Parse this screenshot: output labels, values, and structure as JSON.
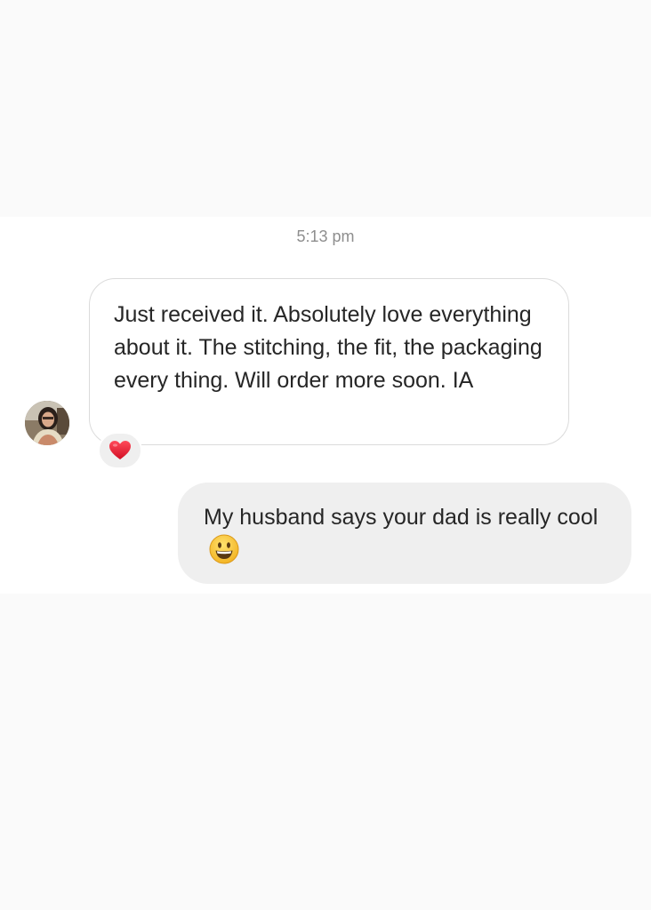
{
  "conversation": {
    "timestamp": "5:13 pm",
    "messages": [
      {
        "direction": "incoming",
        "text": "Just received it. Absolutely love everything about it. The stitching, the fit, the packaging every thing. Will order more soon. IA",
        "reaction_icon": "red-heart-icon"
      },
      {
        "direction": "outgoing",
        "text": "My husband says your dad is really cool",
        "emoji_icon": "grinning-face-icon"
      }
    ]
  },
  "colors": {
    "page_background": "#fafafa",
    "chat_background": "#ffffff",
    "outgoing_bubble": "#efefef",
    "incoming_border": "#dbdbdb",
    "timestamp_text": "#8e8e8e",
    "heart": "#e0182d",
    "emoji_yellow": "#f7c52b"
  }
}
